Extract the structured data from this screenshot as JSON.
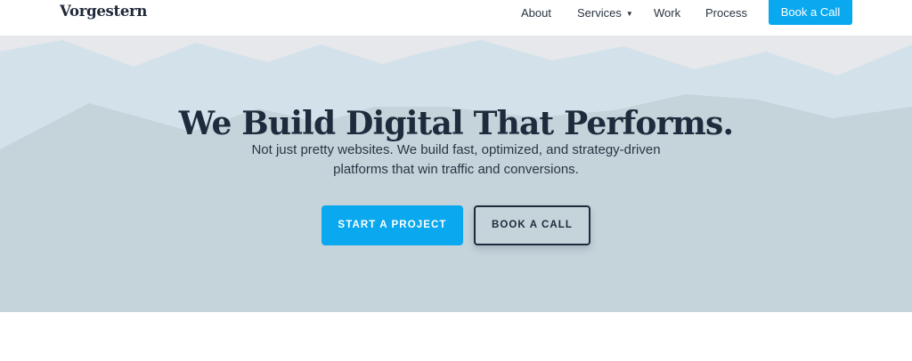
{
  "brand": {
    "name": "Vorgestern",
    "accent": "#0aa8ee",
    "text_dark": "#1d2b3c"
  },
  "nav": {
    "items": [
      {
        "label": "About"
      },
      {
        "label": "Services",
        "has_dropdown": true
      },
      {
        "label": "Work"
      },
      {
        "label": "Process"
      }
    ],
    "cta_label": "Book a Call"
  },
  "hero": {
    "title": "We Build Digital That Performs.",
    "subtitle_line1": "Not just pretty websites. We build fast, optimized, and strategy-driven",
    "subtitle_line2": "platforms that win traffic and conversions.",
    "primary_button": "START A PROJECT",
    "secondary_button": "BOOK A CALL",
    "colors": {
      "sky": "#e6e8eb",
      "mountain_back": "#d3e2ea",
      "mountain_front": "#c5d3db"
    }
  },
  "icons": {
    "dropdown": "caret-down-icon"
  }
}
